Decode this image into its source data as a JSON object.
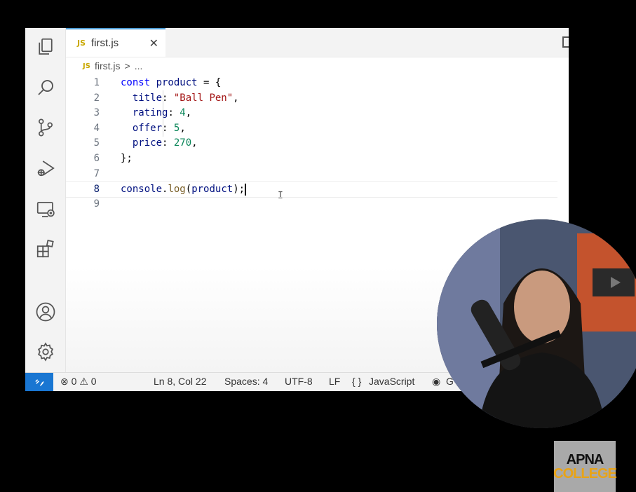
{
  "tab": {
    "icon_label": "JS",
    "title": "first.js",
    "close_glyph": "✕"
  },
  "breadcrumb": {
    "icon_label": "JS",
    "file": "first.js",
    "separator": ">",
    "ellipsis": "..."
  },
  "editor": {
    "active_line": 8,
    "lines": [
      {
        "num": "1",
        "tokens": [
          {
            "t": "const ",
            "c": "kw"
          },
          {
            "t": "product",
            "c": "var"
          },
          {
            "t": " = {",
            "c": ""
          }
        ]
      },
      {
        "num": "2",
        "tokens": [
          {
            "t": "  title",
            "c": "var"
          },
          {
            "t": ": ",
            "c": ""
          },
          {
            "t": "\"Ball Pen\"",
            "c": "str"
          },
          {
            "t": ",",
            "c": ""
          }
        ]
      },
      {
        "num": "3",
        "tokens": [
          {
            "t": "  rating",
            "c": "var"
          },
          {
            "t": ": ",
            "c": ""
          },
          {
            "t": "4",
            "c": "num"
          },
          {
            "t": ",",
            "c": ""
          }
        ]
      },
      {
        "num": "4",
        "tokens": [
          {
            "t": "  offer",
            "c": "var"
          },
          {
            "t": ": ",
            "c": ""
          },
          {
            "t": "5",
            "c": "num"
          },
          {
            "t": ",",
            "c": ""
          }
        ]
      },
      {
        "num": "5",
        "tokens": [
          {
            "t": "  price",
            "c": "var"
          },
          {
            "t": ": ",
            "c": ""
          },
          {
            "t": "270",
            "c": "num"
          },
          {
            "t": ",",
            "c": ""
          }
        ]
      },
      {
        "num": "6",
        "tokens": [
          {
            "t": "};",
            "c": ""
          }
        ]
      },
      {
        "num": "7",
        "tokens": []
      },
      {
        "num": "8",
        "tokens": [
          {
            "t": "console",
            "c": "var"
          },
          {
            "t": ".",
            "c": ""
          },
          {
            "t": "log",
            "c": "fn"
          },
          {
            "t": "(",
            "c": ""
          },
          {
            "t": "product",
            "c": "var"
          },
          {
            "t": ");",
            "c": ""
          }
        ]
      },
      {
        "num": "9",
        "tokens": []
      }
    ]
  },
  "activity_bar": [
    "explorer-icon",
    "search-icon",
    "source-control-icon",
    "run-debug-icon",
    "remote-explorer-icon",
    "extensions-icon",
    "account-icon",
    "settings-gear-icon"
  ],
  "status_bar": {
    "errors": "0",
    "warnings": "0",
    "position": "Ln 8, Col 22",
    "spaces": "Spaces: 4",
    "encoding": "UTF-8",
    "eol": "LF",
    "language_braces": "{ }",
    "language": "JavaScript",
    "trailing": "G"
  },
  "watermark": {
    "line1": "APNA",
    "line2": "COLLEGE"
  },
  "colors": {
    "accent": "#1976d2",
    "keyword": "#0000ff",
    "string": "#a31515",
    "number": "#098658",
    "logo_orange": "#e8a317"
  }
}
